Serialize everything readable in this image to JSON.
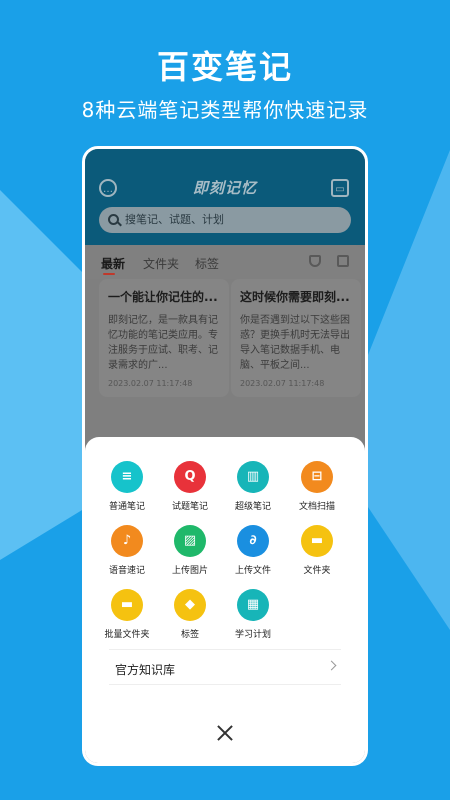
{
  "promo": {
    "headline": "百变笔记",
    "subline": "8种云端笔记类型帮你快速记录"
  },
  "app": {
    "title": "即刻记忆",
    "search_placeholder": "搜笔记、试题、计划",
    "tabs": [
      "最新",
      "文件夹",
      "标签"
    ],
    "cards": [
      {
        "title": "一个能让你记住的...",
        "body": "即刻记忆，是一款具有记忆功能的笔记类应用。专注服务于应试、职考、记录需求的广...",
        "date": "2023.02.07 11:17:48"
      },
      {
        "title": "这时候你需要即刻...",
        "body": "你是否遇到过以下这些困惑？更换手机时无法导出导入笔记数据手机、电脑、平板之间...",
        "date": "2023.02.07 11:17:48"
      }
    ]
  },
  "sheet": {
    "items": [
      {
        "label": "普通笔记",
        "icon": "note-icon",
        "color": "#16c3cb",
        "glyph": "≡"
      },
      {
        "label": "试题笔记",
        "icon": "quiz-icon",
        "color": "#e8323a",
        "glyph": "Q"
      },
      {
        "label": "超级笔记",
        "icon": "book-icon",
        "color": "#17b5b8",
        "glyph": "▥"
      },
      {
        "label": "文档扫描",
        "icon": "scan-icon",
        "color": "#f28a1e",
        "glyph": "⊟"
      },
      {
        "label": "语音速记",
        "icon": "microphone-icon",
        "color": "#f28a1e",
        "glyph": "♪"
      },
      {
        "label": "上传图片",
        "icon": "image-icon",
        "color": "#1fb86a",
        "glyph": "▨"
      },
      {
        "label": "上传文件",
        "icon": "attachment-icon",
        "color": "#1a8fe0",
        "glyph": "∂"
      },
      {
        "label": "文件夹",
        "icon": "folder-icon",
        "color": "#f5c210",
        "glyph": "▬"
      },
      {
        "label": "批量文件夹",
        "icon": "folder-batch-icon",
        "color": "#f5c210",
        "glyph": "▬"
      },
      {
        "label": "标签",
        "icon": "tag-icon",
        "color": "#f5c210",
        "glyph": "◆"
      },
      {
        "label": "学习计划",
        "icon": "calendar-icon",
        "color": "#17b5b8",
        "glyph": "▦"
      }
    ],
    "knowledge_base": "官方知识库"
  }
}
